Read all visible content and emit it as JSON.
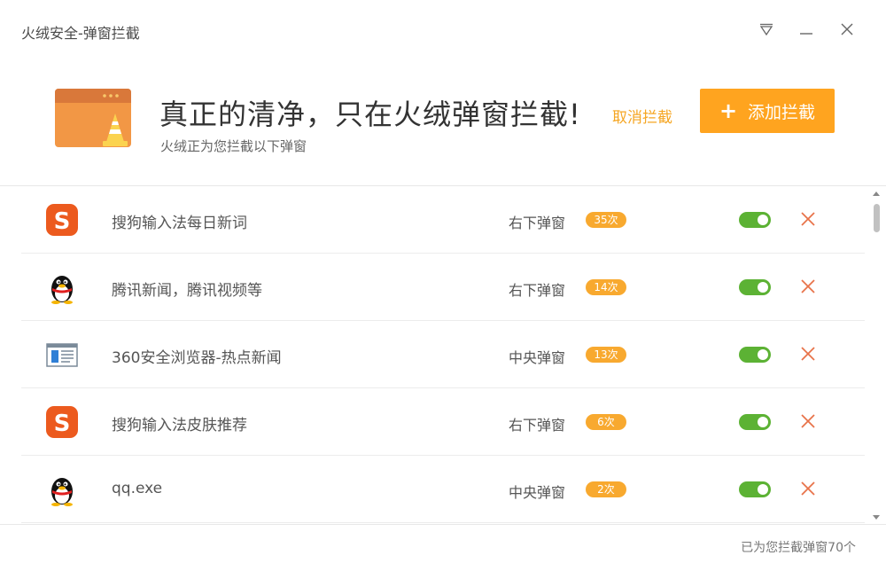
{
  "window": {
    "title": "火绒安全-弹窗拦截"
  },
  "header": {
    "title": "真正的清净，只在火绒弹窗拦截!",
    "subtitle": "火绒正为您拦截以下弹窗",
    "cancel_label": "取消拦截",
    "add_label": "添加拦截",
    "add_icon": "+"
  },
  "colors": {
    "accent": "#ffa41f",
    "toggle_on": "#5cb234",
    "delete": "#e8734a"
  },
  "rows": [
    {
      "name": "搜狗输入法每日新词",
      "type": "右下弹窗",
      "count": "35次",
      "icon": "sogou-icon",
      "enabled": true
    },
    {
      "name": "腾讯新闻，腾讯视频等",
      "type": "右下弹窗",
      "count": "14次",
      "icon": "qq-penguin-icon",
      "enabled": true
    },
    {
      "name": "360安全浏览器-热点新闻",
      "type": "中央弹窗",
      "count": "13次",
      "icon": "browser-window-icon",
      "enabled": true
    },
    {
      "name": "搜狗输入法皮肤推荐",
      "type": "右下弹窗",
      "count": "6次",
      "icon": "sogou-icon",
      "enabled": true
    },
    {
      "name": "qq.exe",
      "type": "中央弹窗",
      "count": "2次",
      "icon": "qq-penguin-icon",
      "enabled": true
    }
  ],
  "footer": {
    "summary": "已为您拦截弹窗70个"
  }
}
